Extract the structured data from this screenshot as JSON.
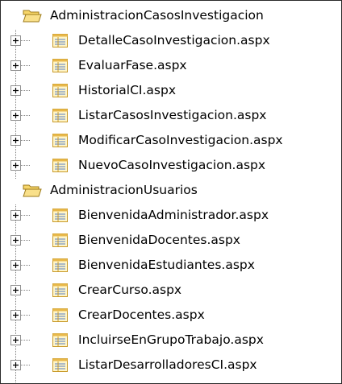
{
  "tree": {
    "folders": [
      {
        "label": "AdministracionCasosInvestigacion",
        "items": [
          "DetalleCasoInvestigacion.aspx",
          "EvaluarFase.aspx",
          "HistorialCI.aspx",
          "ListarCasosInvestigacion.aspx",
          "ModificarCasoInvestigacion.aspx",
          "NuevoCasoInvestigacion.aspx"
        ]
      },
      {
        "label": "AdministracionUsuarios",
        "items": [
          "BienvenidaAdministrador.aspx",
          "BienvenidaDocentes.aspx",
          "BienvenidaEstudiantes.aspx",
          "CrearCurso.aspx",
          "CrearDocentes.aspx",
          "IncluirseEnGrupoTrabajo.aspx",
          "ListarDesarrolladoresCI.aspx"
        ]
      }
    ]
  }
}
